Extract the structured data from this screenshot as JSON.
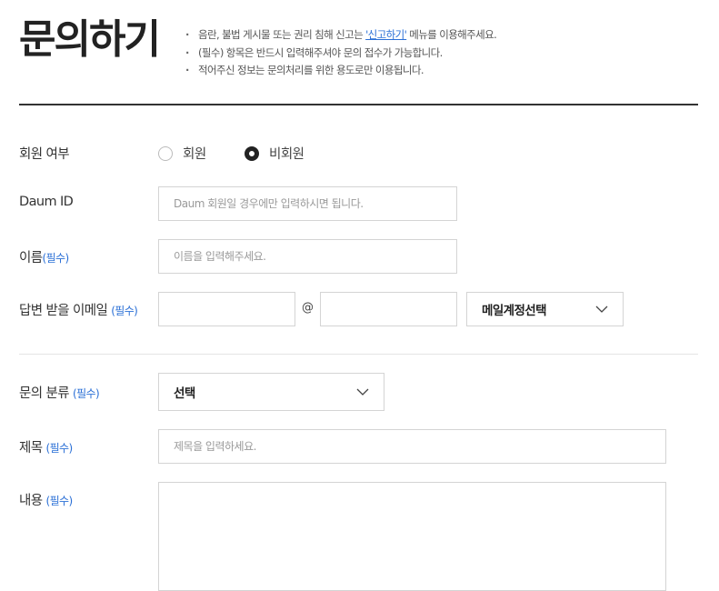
{
  "header": {
    "title": "문의하기",
    "notices": [
      {
        "before": "음란, 불법 게시물 또는 권리 침해 신고는 ",
        "link": "'신고하기'",
        "after": " 메뉴를 이용해주세요."
      },
      {
        "before": "(필수) 항목은 반드시 입력해주셔야 문의 접수가 가능합니다."
      },
      {
        "before": "적어주신 정보는 문의처리를 위한 용도로만 이용됩니다."
      }
    ]
  },
  "form": {
    "membership": {
      "label": "회원 여부",
      "options": [
        {
          "label": "회원",
          "checked": false
        },
        {
          "label": "비회원",
          "checked": true
        }
      ]
    },
    "daum_id": {
      "label": "Daum ID",
      "placeholder": "Daum 회원일 경우에만 입력하시면 됩니다.",
      "value": ""
    },
    "name": {
      "label": "이름",
      "required": "(필수)",
      "placeholder": "이름을 입력해주세요.",
      "value": ""
    },
    "email": {
      "label": "답변 받을 이메일",
      "required": "(필수)",
      "local_value": "",
      "at": "@",
      "domain_value": "",
      "domain_select": "메일계정선택"
    },
    "category": {
      "label": "문의 분류",
      "required": "(필수)",
      "selected": "선택"
    },
    "subject": {
      "label": "제목",
      "required": "(필수)",
      "placeholder": "제목을 입력하세요.",
      "value": ""
    },
    "content": {
      "label": "내용",
      "required": "(필수)",
      "value": ""
    }
  }
}
